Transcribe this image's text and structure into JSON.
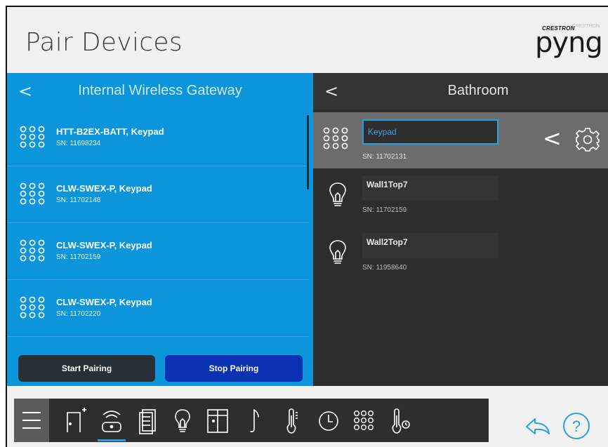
{
  "header": {
    "title": "Pair Devices",
    "brand_small": "CRESTRON",
    "brand_big": "pyng",
    "brand_top": "CRESTRON"
  },
  "left_panel": {
    "back_glyph": "<",
    "title": "Internal Wireless Gateway",
    "devices": [
      {
        "name": "HTT-B2EX-BATT, Keypad",
        "sn": "SN: 11698234",
        "icon": "keypad-icon"
      },
      {
        "name": "CLW-SWEX-P, Keypad",
        "sn": "SN: 11702148",
        "icon": "keypad-icon"
      },
      {
        "name": "CLW-SWEX-P, Keypad",
        "sn": "SN: 11702159",
        "icon": "keypad-icon"
      },
      {
        "name": "CLW-SWEX-P, Keypad",
        "sn": "SN: 11702220",
        "icon": "keypad-icon"
      }
    ],
    "start_label": "Start Pairing",
    "stop_label": "Stop Pairing"
  },
  "right_panel": {
    "back_glyph": "<",
    "title": "Bathroom",
    "selected": {
      "value": "Keypad",
      "sn": "SN: 11702131",
      "chevron": "<",
      "icon": "keypad-icon"
    },
    "loads": [
      {
        "name": "Wall1Top7",
        "sn": "SN: 11702159",
        "icon": "lightbulb-icon"
      },
      {
        "name": "Wall2Top7",
        "sn": "SN: 11958640",
        "icon": "lightbulb-icon"
      }
    ]
  },
  "nav": {
    "items": [
      "menu-icon",
      "door-icon",
      "gateway-icon",
      "shades-icon",
      "lightbulb-icon",
      "window-icon",
      "music-icon",
      "thermometer-icon",
      "clock-icon",
      "keypad-icon",
      "temperature-sensor-icon"
    ],
    "active": "gateway-icon",
    "right_icons": [
      "back-icon",
      "help-icon"
    ],
    "help_glyph": "?"
  },
  "colors": {
    "left_panel_bg": "#0c95da",
    "right_panel_bg": "#2d2d2d",
    "stop_button": "#0a32b3",
    "start_button": "#273036",
    "accent": "#2a9fe0"
  }
}
